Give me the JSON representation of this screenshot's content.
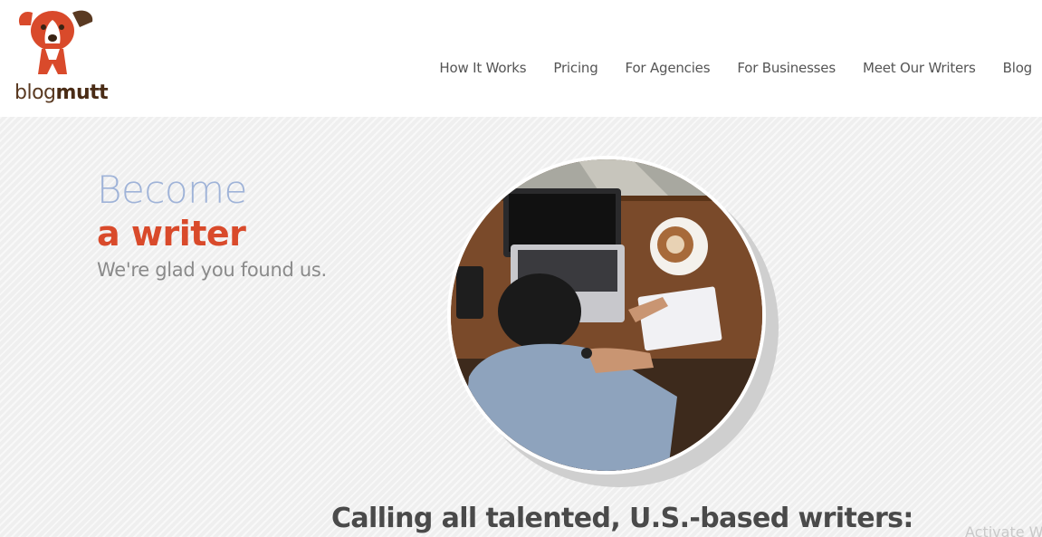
{
  "brand": {
    "name_light": "blog",
    "name_bold": "mutt"
  },
  "nav": [
    {
      "label": "How It Works"
    },
    {
      "label": "Pricing"
    },
    {
      "label": "For Agencies"
    },
    {
      "label": "For Businesses"
    },
    {
      "label": "Meet Our Writers"
    },
    {
      "label": "Blog"
    }
  ],
  "hero": {
    "title_light": "Become",
    "title_bold": "a writer",
    "subtitle": "We're glad you found us.",
    "image_icon": "writer-photo"
  },
  "section": {
    "heading": "Calling all talented, U.S.-based writers:"
  },
  "watermark": {
    "text": "Activate W"
  },
  "colors": {
    "accent_red": "#d94a2b",
    "title_blue": "#9fb3d8",
    "logo_brown": "#5a3a22",
    "background": "#efefef"
  }
}
